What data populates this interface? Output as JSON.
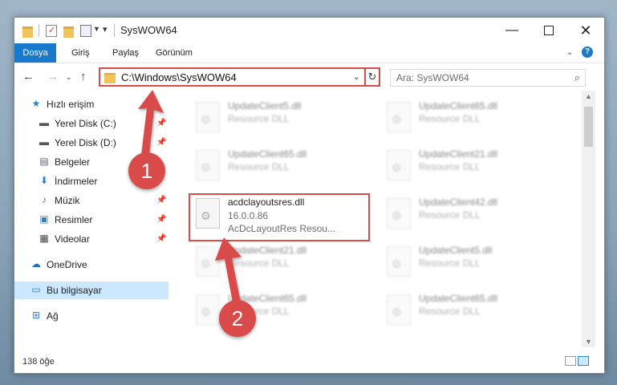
{
  "window": {
    "title": "SysWOW64",
    "controls": {
      "minimize": "—",
      "maximize": "",
      "close": "✕"
    }
  },
  "ribbon": {
    "tabs": [
      "Dosya",
      "Giriş",
      "Paylaş",
      "Görünüm"
    ]
  },
  "address": {
    "path": "C:\\Windows\\SysWOW64",
    "search_placeholder": "Ara: SysWOW64"
  },
  "nav": {
    "quick_access": "Hızlı erişim",
    "items": [
      {
        "label": "Yerel Disk (C:)",
        "icon": "drive-icon"
      },
      {
        "label": "Yerel Disk (D:)",
        "icon": "drive-icon"
      },
      {
        "label": "Belgeler",
        "icon": "documents-icon"
      },
      {
        "label": "İndirmeler",
        "icon": "downloads-icon"
      },
      {
        "label": "Müzik",
        "icon": "music-icon"
      },
      {
        "label": "Resimler",
        "icon": "pictures-icon"
      },
      {
        "label": "Videolar",
        "icon": "videos-icon"
      }
    ],
    "onedrive": "OneDrive",
    "this_pc": "Bu bilgisayar",
    "network": "Ağ"
  },
  "files": {
    "left": [
      {
        "name": "UpdateClient5.dll",
        "sub1": "Resource DLL"
      },
      {
        "name": "UpdateClient65.dll",
        "sub1": "Resource DLL"
      },
      {
        "name": "acdclayoutsres.dll",
        "sub1": "16.0.0.86",
        "sub2": "AcDcLayoutRes Resou..."
      },
      {
        "name": "UpdateClient21.dll",
        "sub1": "Resource DLL"
      },
      {
        "name": "UpdateClient65.dll",
        "sub1": "Resource DLL"
      }
    ],
    "right": [
      {
        "name": "UpdateClient65.dll",
        "sub1": "Resource DLL"
      },
      {
        "name": "UpdateClient21.dll",
        "sub1": "Resource DLL"
      },
      {
        "name": "UpdateClient42.dll",
        "sub1": "Resource DLL"
      },
      {
        "name": "UpdateClient5.dll",
        "sub1": "Resource DLL"
      },
      {
        "name": "UpdateClient65.dll",
        "sub1": "Resource DLL"
      }
    ]
  },
  "status": {
    "count": "138 öğe"
  },
  "annotations": {
    "step1": "1",
    "step2": "2",
    "color": "#d94b4b"
  }
}
